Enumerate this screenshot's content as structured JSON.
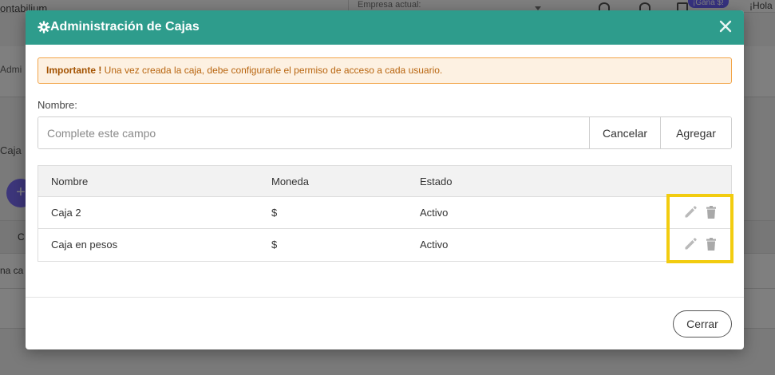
{
  "background": {
    "brand": "ontabilium",
    "company_label": "Empresa actual:",
    "badge": "¡Gana $!",
    "greeting": "¡Hola",
    "sub_label": "Admi",
    "caja_label": "Caja",
    "plus": "+",
    "table_header_fragment": "C",
    "row_fragment": "na ca"
  },
  "modal": {
    "title": "Administración de Cajas",
    "close_icon": "close-icon",
    "alert": {
      "strong": "Importante !",
      "text": " Una vez creada la caja, debe configurarle el permiso de acceso a cada usuario."
    },
    "form": {
      "label": "Nombre:",
      "placeholder": "Complete este campo",
      "value": "",
      "cancel_label": "Cancelar",
      "add_label": "Agregar"
    },
    "table": {
      "headers": [
        "Nombre",
        "Moneda",
        "Estado"
      ],
      "rows": [
        {
          "nombre": "Caja 2",
          "moneda": "$",
          "estado": "Activo"
        },
        {
          "nombre": "Caja en pesos",
          "moneda": "$",
          "estado": "Activo"
        }
      ]
    },
    "footer": {
      "close_label": "Cerrar"
    }
  },
  "colors": {
    "header": "#2e9c8c",
    "alert_border": "#f2a549",
    "alert_bg": "#fdf1e2",
    "highlight": "#f2cc0f",
    "accent_purple": "#7b6cf6"
  }
}
